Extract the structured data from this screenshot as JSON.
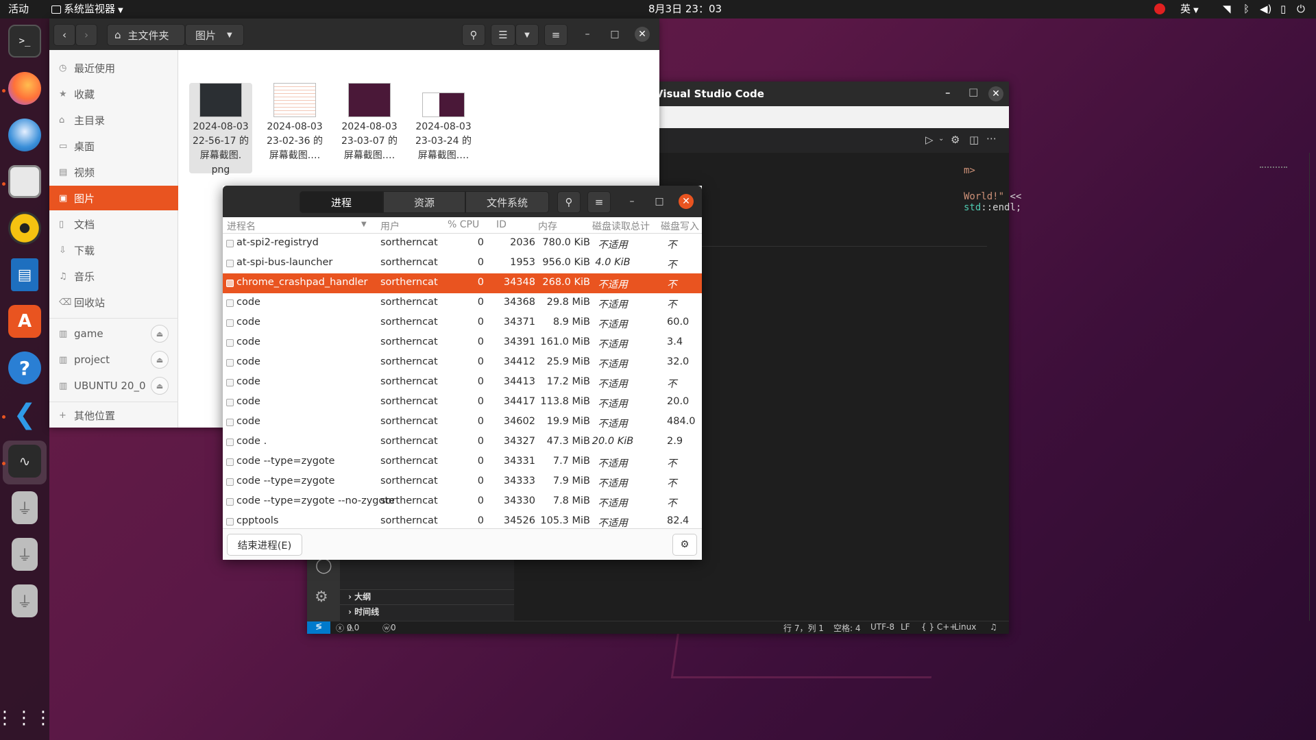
{
  "topbar": {
    "activities": "活动",
    "app_menu": "系统监视器",
    "clock": "8月3日  23：03",
    "input_method": "英"
  },
  "dock": {
    "icons": [
      "terminal-icon",
      "firefox-icon",
      "thunderbird-icon",
      "files-icon",
      "rhythmbox-icon",
      "writer-icon",
      "software-icon",
      "help-icon",
      "vscode-icon",
      "system-monitor-icon",
      "usb-drive-icon",
      "usb-drive-icon",
      "usb-drive-icon",
      "app-grid-icon"
    ]
  },
  "files": {
    "path_home": "主文件夹",
    "path_current": "图片",
    "sidebar": [
      {
        "label": "最近使用",
        "icon": "clock-icon"
      },
      {
        "label": "收藏",
        "icon": "star-icon"
      },
      {
        "label": "主目录",
        "icon": "home-icon"
      },
      {
        "label": "桌面",
        "icon": "desktop-icon"
      },
      {
        "label": "视频",
        "icon": "video-icon"
      },
      {
        "label": "图片",
        "icon": "picture-icon"
      },
      {
        "label": "文档",
        "icon": "document-icon"
      },
      {
        "label": "下载",
        "icon": "download-icon"
      },
      {
        "label": "音乐",
        "icon": "music-icon"
      },
      {
        "label": "回收站",
        "icon": "trash-icon"
      },
      {
        "label": "game",
        "icon": "drive-icon"
      },
      {
        "label": "project",
        "icon": "drive-icon"
      },
      {
        "label": "UBUNTU 20_0",
        "icon": "drive-icon"
      },
      {
        "label": "其他位置",
        "icon": "plus-icon"
      }
    ],
    "thumbs": [
      {
        "line1": "2024-08-03",
        "line2": "22-56-17 的",
        "line3": "屏幕截图.",
        "line4": "png"
      },
      {
        "line1": "2024-08-03",
        "line2": "23-02-36 的",
        "line3": "屏幕截图.…",
        "line4": ""
      },
      {
        "line1": "2024-08-03",
        "line2": "23-03-07 的",
        "line3": "屏幕截图.…",
        "line4": ""
      },
      {
        "line1": "2024-08-03",
        "line2": "23-03-24 的",
        "line3": "屏幕截图.…",
        "line4": ""
      }
    ]
  },
  "vscode": {
    "title": "Visual Studio Code",
    "code_line": "World!\" << std::endl;",
    "code_prefix": "m>",
    "outline": "大纲",
    "timeline": "时间线",
    "status": {
      "errors": "0",
      "warnings": "0",
      "ports": "0",
      "position": "行 7，列 1",
      "spaces": "空格: 4",
      "encoding": "UTF-8",
      "eol": "LF",
      "lang": "{ } C++",
      "os": "Linux"
    }
  },
  "sysmon": {
    "tabs": [
      "进程",
      "资源",
      "文件系统"
    ],
    "columns": {
      "name": "进程名",
      "user": "用户",
      "cpu": "% CPU",
      "id": "ID",
      "mem": "内存",
      "read": "磁盘读取总计",
      "write": "磁盘写入"
    },
    "rows": [
      {
        "name": "at-spi2-registryd",
        "user": "sortherncat",
        "cpu": "0",
        "id": "2036",
        "mem": "780.0 KiB",
        "read": "不适用",
        "write": "不"
      },
      {
        "name": "at-spi-bus-launcher",
        "user": "sortherncat",
        "cpu": "0",
        "id": "1953",
        "mem": "956.0 KiB",
        "read": "4.0 KiB",
        "write": "不"
      },
      {
        "name": "chrome_crashpad_handler",
        "user": "sortherncat",
        "cpu": "0",
        "id": "34348",
        "mem": "268.0 KiB",
        "read": "不适用",
        "write": "不"
      },
      {
        "name": "code",
        "user": "sortherncat",
        "cpu": "0",
        "id": "34368",
        "mem": "29.8 MiB",
        "read": "不适用",
        "write": "不"
      },
      {
        "name": "code",
        "user": "sortherncat",
        "cpu": "0",
        "id": "34371",
        "mem": "8.9 MiB",
        "read": "不适用",
        "write": "60.0"
      },
      {
        "name": "code",
        "user": "sortherncat",
        "cpu": "0",
        "id": "34391",
        "mem": "161.0 MiB",
        "read": "不适用",
        "write": "3.4"
      },
      {
        "name": "code",
        "user": "sortherncat",
        "cpu": "0",
        "id": "34412",
        "mem": "25.9 MiB",
        "read": "不适用",
        "write": "32.0"
      },
      {
        "name": "code",
        "user": "sortherncat",
        "cpu": "0",
        "id": "34413",
        "mem": "17.2 MiB",
        "read": "不适用",
        "write": "不"
      },
      {
        "name": "code",
        "user": "sortherncat",
        "cpu": "0",
        "id": "34417",
        "mem": "113.8 MiB",
        "read": "不适用",
        "write": "20.0"
      },
      {
        "name": "code",
        "user": "sortherncat",
        "cpu": "0",
        "id": "34602",
        "mem": "19.9 MiB",
        "read": "不适用",
        "write": "484.0"
      },
      {
        "name": "code .",
        "user": "sortherncat",
        "cpu": "0",
        "id": "34327",
        "mem": "47.3 MiB",
        "read": "20.0 KiB",
        "write": "2.9"
      },
      {
        "name": "code --type=zygote",
        "user": "sortherncat",
        "cpu": "0",
        "id": "34331",
        "mem": "7.7 MiB",
        "read": "不适用",
        "write": "不"
      },
      {
        "name": "code --type=zygote",
        "user": "sortherncat",
        "cpu": "0",
        "id": "34333",
        "mem": "7.9 MiB",
        "read": "不适用",
        "write": "不"
      },
      {
        "name": "code --type=zygote --no-zygote",
        "user": "sortherncat",
        "cpu": "0",
        "id": "34330",
        "mem": "7.8 MiB",
        "read": "不适用",
        "write": "不"
      },
      {
        "name": "cpptools",
        "user": "sortherncat",
        "cpu": "0",
        "id": "34526",
        "mem": "105.3 MiB",
        "read": "不适用",
        "write": "82.4"
      }
    ],
    "end_process": "结束进程(E)"
  }
}
